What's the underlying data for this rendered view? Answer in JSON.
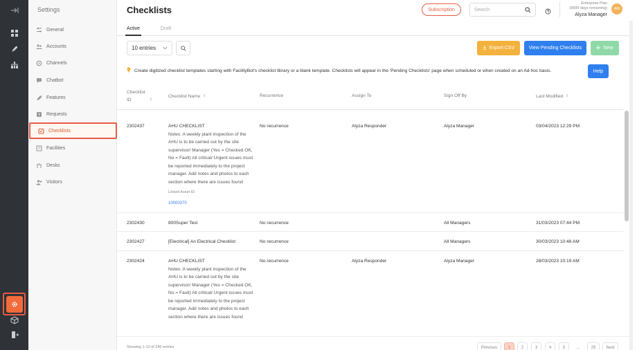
{
  "header": {
    "title": "Checklists",
    "subscription_label": "Subscription",
    "search_placeholder": "Search",
    "plan_line1": "Enterprise Plan",
    "plan_line2": "(9999 days remaining)",
    "user_name": "Alyza Manager",
    "avatar_initials": "AM"
  },
  "sidebar": {
    "title": "Settings",
    "items": [
      {
        "label": "General",
        "icon": "sliders-icon"
      },
      {
        "label": "Accounts",
        "icon": "users-icon"
      },
      {
        "label": "Channels",
        "icon": "channels-icon"
      },
      {
        "label": "Chatbot",
        "icon": "chat-icon"
      },
      {
        "label": "Features",
        "icon": "rocket-icon"
      },
      {
        "label": "Requests",
        "icon": "request-icon"
      },
      {
        "label": "Checklists",
        "icon": "checklist-icon",
        "selected": true
      },
      {
        "label": "Facilities",
        "icon": "building-icon"
      },
      {
        "label": "Desks",
        "icon": "desk-icon"
      },
      {
        "label": "Visitors",
        "icon": "visitor-icon"
      }
    ]
  },
  "tabs": {
    "active": "Active",
    "draft": "Draft"
  },
  "toolbar": {
    "entries_value": "10 entries",
    "export_label": "Export CSV",
    "pending_label": "View Pending Checklists",
    "new_label": "New"
  },
  "info": {
    "text": "Create digitized checklist templates starting with FacilityBot's checklist library or a blank template. Checklists will appear in the 'Pending Checklists' page when scheduled or when created on an Ad-hoc basis.",
    "help_label": "Help"
  },
  "table": {
    "headers": [
      "Checklist ID",
      "Checklist Name",
      "Recurrence",
      "Assign To",
      "Sign Off By",
      "Last Modified"
    ],
    "header_id_line1": "Checklist",
    "header_id_line2": "ID",
    "rows": [
      {
        "id": "2302437",
        "name": "AHU CHECKLIST",
        "notes": "Notes: A weekly plant inspection of the AHU is to be carried out by the site supervisor/ Manager (Yes = Checked OK, No = Fault) All critical/ Urgent issues must be reported immediately to the project manager. Add notes and photos to each section where there are issues found",
        "linked_label": "Linked Asset ID",
        "asset_id": "10000370",
        "recurrence": "No recurrence",
        "assign_to": "Alyza Responder",
        "sign_off": "Alyza Manager",
        "modified": "03/04/2023 12:29 PM"
      },
      {
        "id": "2302430",
        "name": "800Super Test",
        "recurrence": "No recurrence",
        "assign_to": "",
        "sign_off": "All Managers",
        "modified": "31/03/2023 07:44 PM"
      },
      {
        "id": "2302427",
        "name": "[Electrical] An Electrical Checklist",
        "recurrence": "No recurrence",
        "assign_to": "",
        "sign_off": "All Managers",
        "modified": "30/03/2023 10:48 AM"
      },
      {
        "id": "2302424",
        "name": "AHU CHECKLIST",
        "notes": "Notes: A weekly plant inspection of the AHU is to be carried out by the site supervisor/ Manager (Yes = Checked OK, No = Fault) All critical/ Urgent issues must be reported immediately to the project manager. Add notes and photos to each section where there are issues found",
        "recurrence": "No recurrence",
        "assign_to": "Alyza Responder",
        "sign_off": "Alyza Manager",
        "modified": "28/03/2023 10:19 AM"
      }
    ]
  },
  "footer": {
    "showing": "Showing 1-10 of 246 entries",
    "pages": [
      "Previous",
      "1",
      "2",
      "3",
      "4",
      "5",
      "...",
      "25",
      "Next"
    ],
    "current_page": "1"
  },
  "colors": {
    "accent": "#e85b45",
    "primary_blue": "#2f7fef",
    "export_yellow": "#f3b23d",
    "new_green": "#8fd9a8",
    "rail_dark": "#2f3237"
  }
}
